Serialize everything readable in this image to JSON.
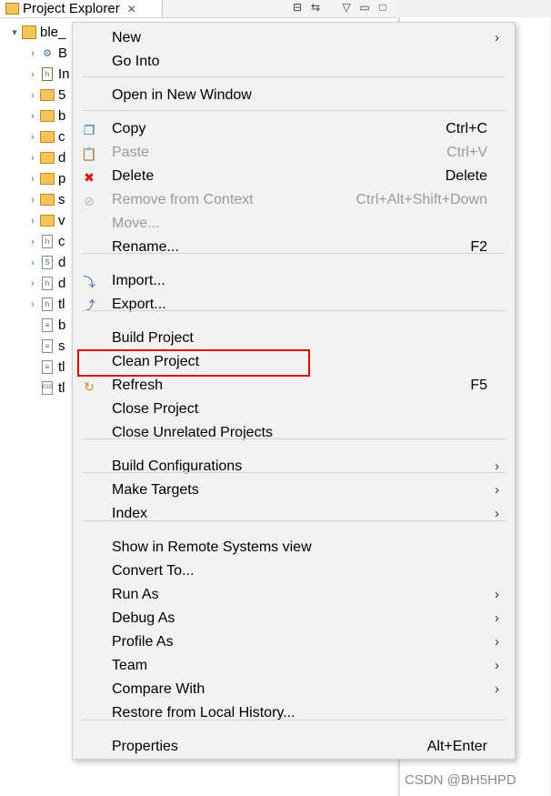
{
  "view": {
    "tab_title": "Project Explorer",
    "tree": {
      "project_label": "ble_",
      "children": [
        {
          "label": "B",
          "icon": "binaries-icon",
          "expandable": true
        },
        {
          "label": "In",
          "icon": "includes-icon",
          "expandable": true
        },
        {
          "label": "5",
          "icon": "folder-icon",
          "expandable": true
        },
        {
          "label": "b",
          "icon": "folder-icon",
          "expandable": true
        },
        {
          "label": "c",
          "icon": "folder-icon",
          "expandable": true
        },
        {
          "label": "d",
          "icon": "folder-icon",
          "expandable": true
        },
        {
          "label": "p",
          "icon": "folder-icon",
          "expandable": true
        },
        {
          "label": "s",
          "icon": "folder-icon",
          "expandable": true
        },
        {
          "label": "v",
          "icon": "folder-icon",
          "expandable": true
        },
        {
          "label": "c",
          "icon": "header-file-icon",
          "expandable": true
        },
        {
          "label": "d",
          "icon": "source-file-icon",
          "expandable": true
        },
        {
          "label": "d",
          "icon": "header-file-icon",
          "expandable": true
        },
        {
          "label": "tl",
          "icon": "header-file-icon",
          "expandable": true
        },
        {
          "label": "b",
          "icon": "text-file-icon",
          "expandable": false
        },
        {
          "label": "s",
          "icon": "text-file-icon",
          "expandable": false
        },
        {
          "label": "tl",
          "icon": "text-file-icon",
          "expandable": false
        },
        {
          "label": "tl",
          "icon": "binary-file-icon",
          "expandable": false
        }
      ]
    }
  },
  "menu": {
    "items": [
      {
        "label": "New",
        "shortcut": "",
        "submenu": true,
        "enabled": true,
        "icon": ""
      },
      {
        "label": "Go Into",
        "shortcut": "",
        "submenu": false,
        "enabled": true,
        "icon": ""
      },
      {
        "label": "Open in New Window",
        "shortcut": "",
        "submenu": false,
        "enabled": true,
        "icon": ""
      },
      {
        "label": "Copy",
        "shortcut": "Ctrl+C",
        "submenu": false,
        "enabled": true,
        "icon": "copy-icon"
      },
      {
        "label": "Paste",
        "shortcut": "Ctrl+V",
        "submenu": false,
        "enabled": false,
        "icon": "paste-icon"
      },
      {
        "label": "Delete",
        "shortcut": "Delete",
        "submenu": false,
        "enabled": true,
        "icon": "delete-icon"
      },
      {
        "label": "Remove from Context",
        "shortcut": "Ctrl+Alt+Shift+Down",
        "submenu": false,
        "enabled": false,
        "icon": "remove-context-icon"
      },
      {
        "label": "Move...",
        "shortcut": "",
        "submenu": false,
        "enabled": false,
        "icon": ""
      },
      {
        "label": "Rename...",
        "shortcut": "F2",
        "submenu": false,
        "enabled": true,
        "icon": ""
      },
      {
        "label": "Import...",
        "shortcut": "",
        "submenu": false,
        "enabled": true,
        "icon": "import-icon"
      },
      {
        "label": "Export...",
        "shortcut": "",
        "submenu": false,
        "enabled": true,
        "icon": "export-icon"
      },
      {
        "label": "Build Project",
        "shortcut": "",
        "submenu": false,
        "enabled": true,
        "icon": ""
      },
      {
        "label": "Clean Project",
        "shortcut": "",
        "submenu": false,
        "enabled": true,
        "icon": ""
      },
      {
        "label": "Refresh",
        "shortcut": "F5",
        "submenu": false,
        "enabled": true,
        "icon": "refresh-icon"
      },
      {
        "label": "Close Project",
        "shortcut": "",
        "submenu": false,
        "enabled": true,
        "icon": ""
      },
      {
        "label": "Close Unrelated Projects",
        "shortcut": "",
        "submenu": false,
        "enabled": true,
        "icon": ""
      },
      {
        "label": "Build Configurations",
        "shortcut": "",
        "submenu": true,
        "enabled": true,
        "icon": ""
      },
      {
        "label": "Make Targets",
        "shortcut": "",
        "submenu": true,
        "enabled": true,
        "icon": ""
      },
      {
        "label": "Index",
        "shortcut": "",
        "submenu": true,
        "enabled": true,
        "icon": ""
      },
      {
        "label": "Show in Remote Systems view",
        "shortcut": "",
        "submenu": false,
        "enabled": true,
        "icon": ""
      },
      {
        "label": "Convert To...",
        "shortcut": "",
        "submenu": false,
        "enabled": true,
        "icon": ""
      },
      {
        "label": "Run As",
        "shortcut": "",
        "submenu": true,
        "enabled": true,
        "icon": ""
      },
      {
        "label": "Debug As",
        "shortcut": "",
        "submenu": true,
        "enabled": true,
        "icon": ""
      },
      {
        "label": "Profile As",
        "shortcut": "",
        "submenu": true,
        "enabled": true,
        "icon": ""
      },
      {
        "label": "Team",
        "shortcut": "",
        "submenu": true,
        "enabled": true,
        "icon": ""
      },
      {
        "label": "Compare With",
        "shortcut": "",
        "submenu": true,
        "enabled": true,
        "icon": ""
      },
      {
        "label": "Restore from Local History...",
        "shortcut": "",
        "submenu": false,
        "enabled": true,
        "icon": ""
      },
      {
        "label": "Properties",
        "shortcut": "Alt+Enter",
        "submenu": false,
        "enabled": true,
        "icon": ""
      }
    ],
    "highlighted_item": "Clean Project",
    "highlight_color": "#e00000"
  },
  "watermark": "CSDN @BH5HPD"
}
